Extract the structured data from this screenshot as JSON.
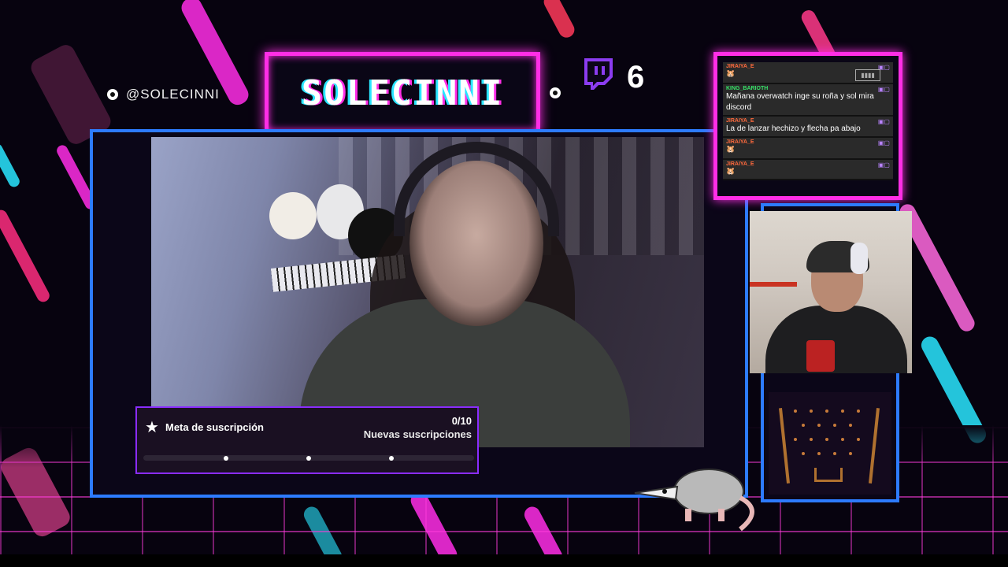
{
  "overlay": {
    "handle": "@SOLECINNI",
    "logo_text": "SOLECINNI",
    "viewer_count": "6",
    "colors": {
      "accent_pink": "#ff2ee6",
      "accent_blue": "#2d7bff",
      "accent_cyan": "#29e6ff"
    }
  },
  "goal": {
    "title": "Meta de suscripción",
    "count": "0/10",
    "subtitle": "Nuevas suscripciones",
    "progress_fraction": 0
  },
  "chat": {
    "messages": [
      {
        "user": "JIRAIYA_E",
        "user_color": "#ff6a3d",
        "text": "",
        "emote": "🐹"
      },
      {
        "user": "KING_BARIOTH",
        "user_color": "#37e067",
        "text": "Mañana overwatch inge su roña y sol mira discord",
        "emote": ""
      },
      {
        "user": "JIRAIYA_E",
        "user_color": "#ff6a3d",
        "text": "La de lanzar hechizo y flecha pa abajo",
        "emote": ""
      },
      {
        "user": "JIRAIYA_E",
        "user_color": "#ff6a3d",
        "text": "",
        "emote": "🐹"
      },
      {
        "user": "JIRAIYA_E",
        "user_color": "#ff6a3d",
        "text": "",
        "emote": "🐹"
      }
    ]
  },
  "icons": {
    "twitch": "twitch-logo-icon",
    "goal_star": "star-icon",
    "battery": "battery-icon",
    "dot": "dot-icon"
  }
}
